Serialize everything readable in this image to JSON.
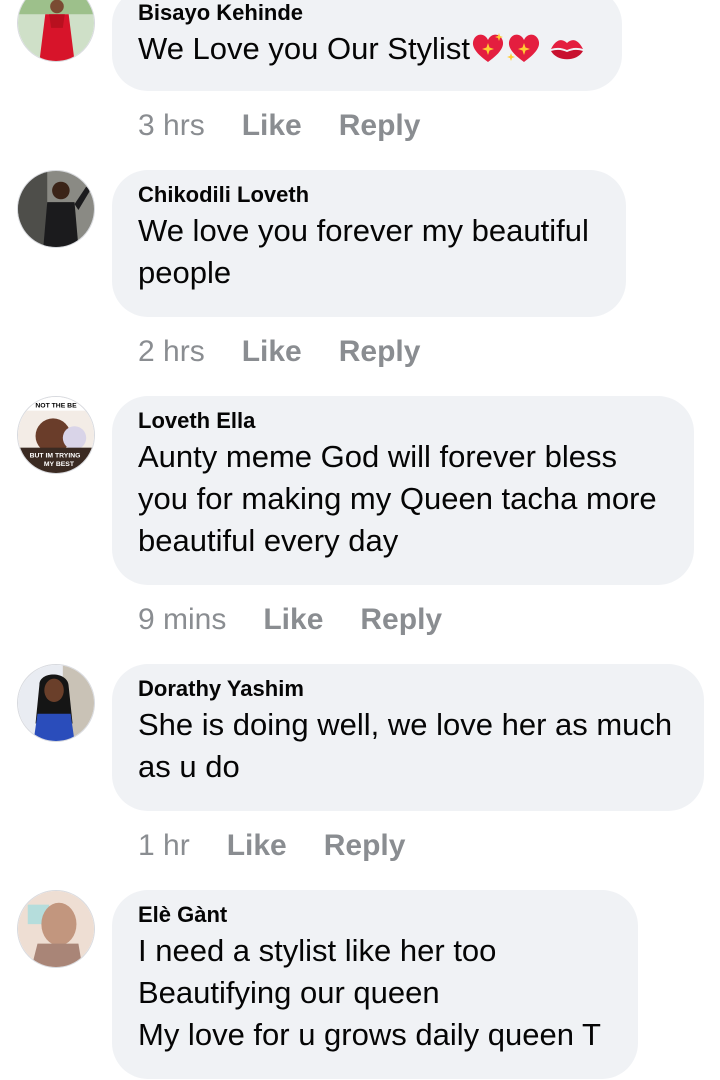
{
  "comments": [
    {
      "author": "Bisayo Kehinde",
      "text": "We Love you Our Stylist",
      "emojis": [
        "sparkling-heart-emoji",
        "sparkling-heart-emoji",
        "kiss-mark-emoji"
      ],
      "time": "3 hrs",
      "like_label": "Like",
      "reply_label": "Reply"
    },
    {
      "author": "Chikodili Loveth",
      "text": "We love you forever my beautiful\npeople",
      "time": "2 hrs",
      "like_label": "Like",
      "reply_label": "Reply"
    },
    {
      "author": "Loveth Ella",
      "text": "Aunty meme God will forever bless\nyou for making my Queen tacha more\nbeautiful every day",
      "avatar_text": [
        "NOT THE BE",
        "BUT IM TRYING",
        "MY BEST"
      ],
      "time": "9 mins",
      "like_label": "Like",
      "reply_label": "Reply"
    },
    {
      "author": "Dorathy Yashim",
      "text": "She is doing well, we love her as much\nas u do",
      "time": "1 hr",
      "like_label": "Like",
      "reply_label": "Reply"
    },
    {
      "author": "Elè Gànt",
      "text": "I need a stylist like her too\nBeautifying our queen\nMy love for u grows daily queen T"
    }
  ],
  "colors": {
    "bubble_bg": "#f0f2f5",
    "text": "#050505",
    "meta_text": "#8a8d91",
    "heart_red": "#e41e3f",
    "sparkle_yellow": "#ffcc33"
  }
}
